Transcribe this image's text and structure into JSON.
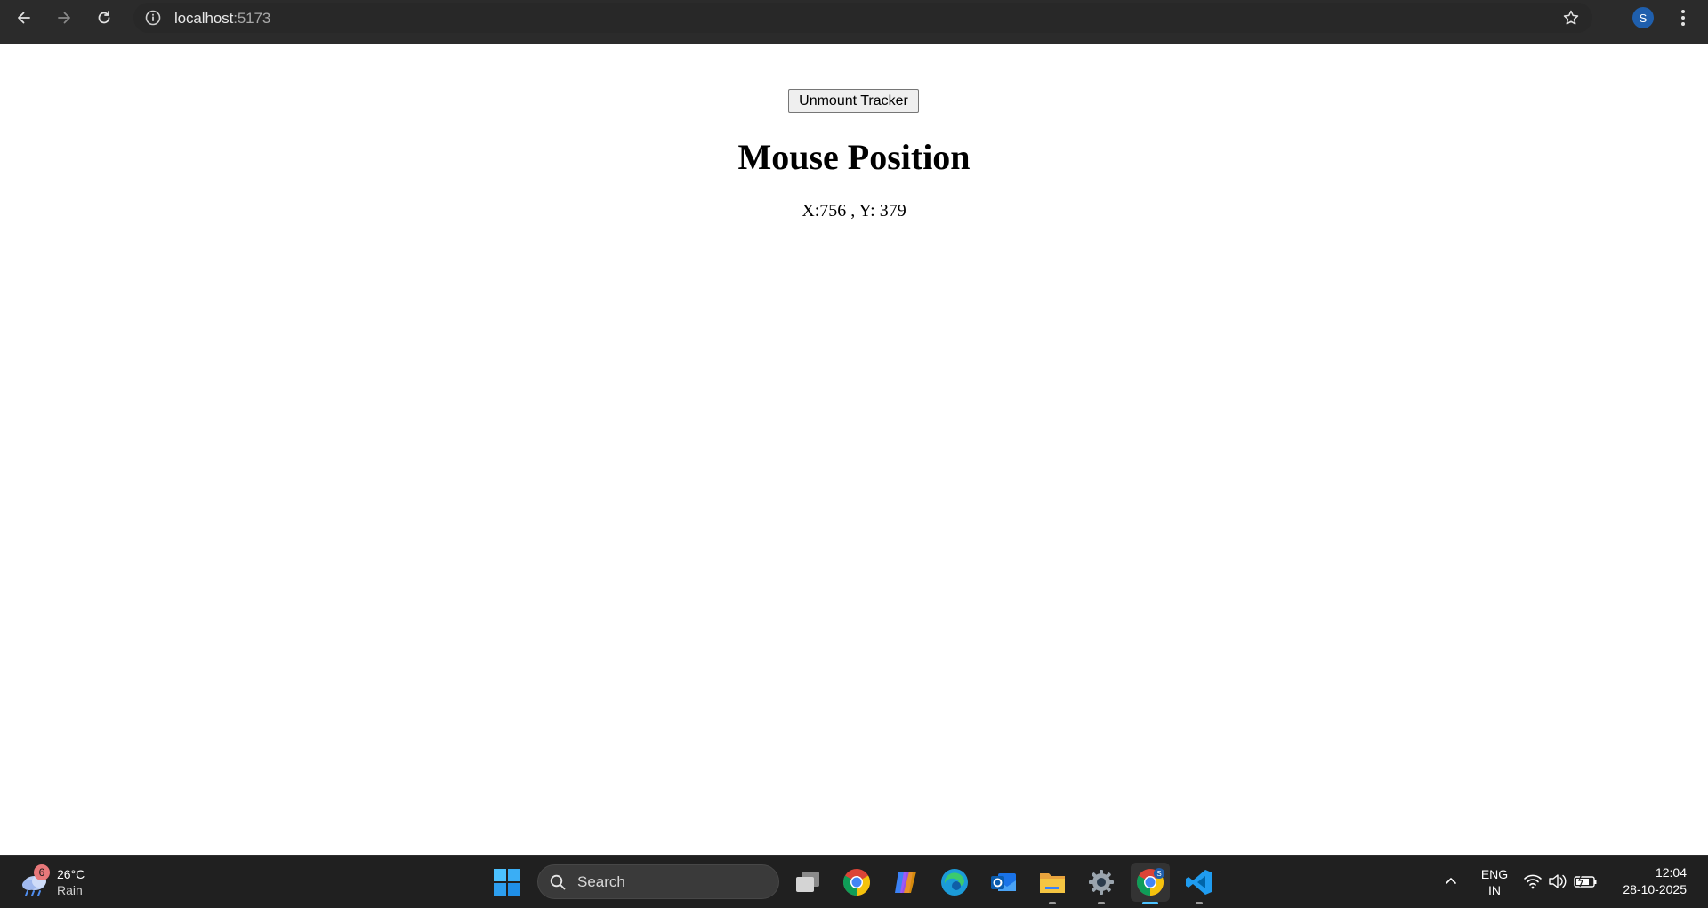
{
  "browser": {
    "url_host": "localhost",
    "url_port": ":5173",
    "profile_initial": "S",
    "icons": [
      "back-icon",
      "forward-icon",
      "reload-icon",
      "site-info-icon",
      "bookmark-star-icon",
      "profile-avatar",
      "more-menu-icon"
    ]
  },
  "page": {
    "button_label": "Unmount Tracker",
    "title": "Mouse Position",
    "coords_text": "X:756 , Y: 379"
  },
  "taskbar": {
    "weather": {
      "badge": "6",
      "temperature": "26°C",
      "condition": "Rain"
    },
    "search_label": "Search",
    "apps": [
      "task-view",
      "chrome",
      "copilot",
      "edge",
      "outlook",
      "file-explorer",
      "settings",
      "chrome-profile",
      "vscode"
    ],
    "language_line1": "ENG",
    "language_line2": "IN",
    "time": "12:04",
    "date": "28-10-2025",
    "chrome_profile_badge": "S"
  },
  "colors": {
    "toolbar_bg": "#3c3c3c",
    "omnibox_bg": "#282828",
    "taskbar_bg": "#202020",
    "avatar_blue": "#1f5fad",
    "accent_indicator": "#4cc2ff"
  }
}
